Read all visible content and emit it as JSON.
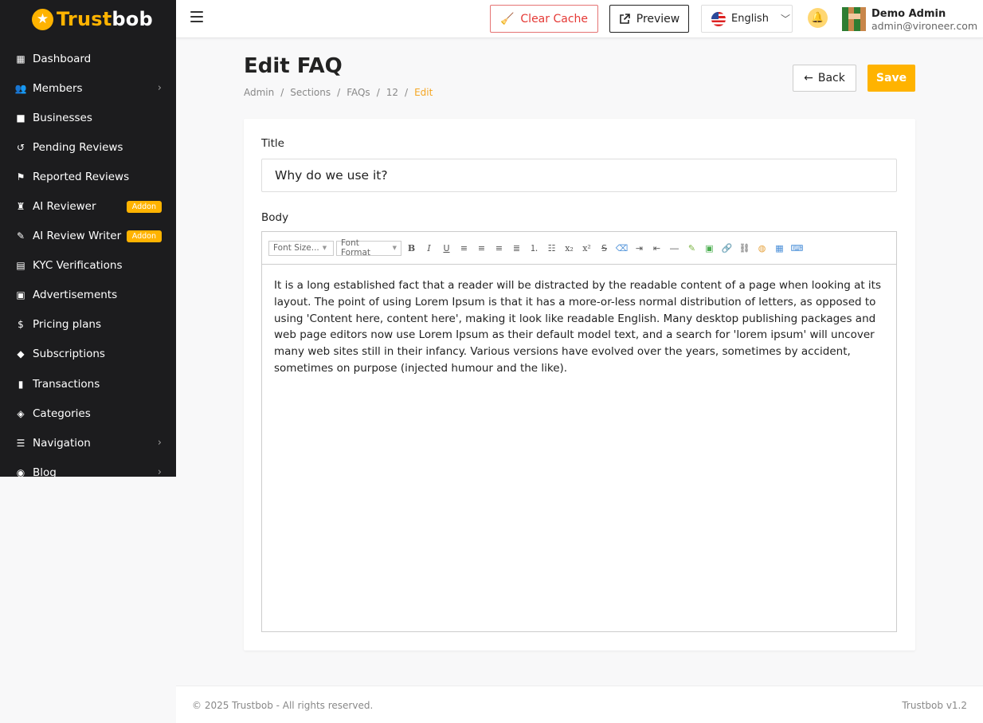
{
  "brand": {
    "part1": "Trust",
    "part2": "bob"
  },
  "sidebar": {
    "items": [
      {
        "label": "Dashboard",
        "icon": "dashboard-icon",
        "glyph": "▦"
      },
      {
        "label": "Members",
        "icon": "users-icon",
        "glyph": "👥",
        "chevron": true
      },
      {
        "label": "Businesses",
        "icon": "briefcase-icon",
        "glyph": "■"
      },
      {
        "label": "Pending Reviews",
        "icon": "history-icon",
        "glyph": "↺"
      },
      {
        "label": "Reported Reviews",
        "icon": "flag-icon",
        "glyph": "⚑"
      },
      {
        "label": "AI Reviewer",
        "icon": "robot-icon",
        "glyph": "♜",
        "badge": "Addon"
      },
      {
        "label": "AI Review Writer",
        "icon": "pen-icon",
        "glyph": "✎",
        "badge": "Addon"
      },
      {
        "label": "KYC Verifications",
        "icon": "id-card-icon",
        "glyph": "▤"
      },
      {
        "label": "Advertisements",
        "icon": "ad-icon",
        "glyph": "▣"
      },
      {
        "label": "Pricing plans",
        "icon": "money-icon",
        "glyph": "$"
      },
      {
        "label": "Subscriptions",
        "icon": "gem-icon",
        "glyph": "◆"
      },
      {
        "label": "Transactions",
        "icon": "receipt-icon",
        "glyph": "▮"
      },
      {
        "label": "Categories",
        "icon": "tags-icon",
        "glyph": "◈"
      },
      {
        "label": "Navigation",
        "icon": "list-icon",
        "glyph": "☰",
        "chevron": true
      },
      {
        "label": "Blog",
        "icon": "rss-icon",
        "glyph": "◉",
        "chevron": true
      }
    ]
  },
  "topbar": {
    "clear_cache": "Clear Cache",
    "preview": "Preview",
    "language": "English",
    "user_name": "Demo Admin",
    "user_email": "admin@vironeer.com"
  },
  "page": {
    "title": "Edit FAQ",
    "breadcrumb": [
      "Admin",
      "Sections",
      "FAQs",
      "12",
      "Edit"
    ],
    "back": "Back",
    "save": "Save"
  },
  "form": {
    "title_label": "Title",
    "title_value": "Why do we use it?",
    "body_label": "Body",
    "font_size": "Font Size...",
    "font_format": "Font Format",
    "body_text": "It is a long established fact that a reader will be distracted by the readable content of a page when looking at its layout. The point of using Lorem Ipsum is that it has a more-or-less normal distribution of letters, as opposed to using 'Content here, content here', making it look like readable English. Many desktop publishing packages and web page editors now use Lorem Ipsum as their default model text, and a search for 'lorem ipsum' will uncover many web sites still in their infancy. Various versions have evolved over the years, sometimes by accident, sometimes on purpose (injected humour and the like)."
  },
  "footer": {
    "copyright": "© 2025 Trustbob - All rights reserved.",
    "version": "Trustbob v1.2"
  }
}
